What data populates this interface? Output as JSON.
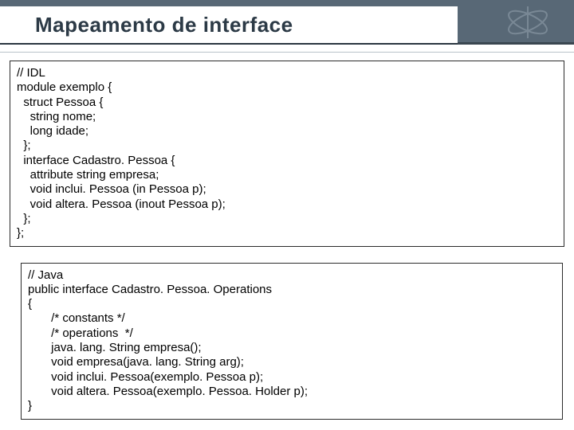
{
  "title": "Mapeamento de interface",
  "idl": {
    "l1": "// IDL",
    "l2": "module exemplo {",
    "l3": "  struct Pessoa {",
    "l4": "    string nome;",
    "l5": "    long idade;",
    "l6": "  };",
    "l7": "  interface Cadastro. Pessoa {",
    "l8": "    attribute string empresa;",
    "l9": "    void inclui. Pessoa (in Pessoa p);",
    "l10": "    void altera. Pessoa (inout Pessoa p);",
    "l11": "  };",
    "l12": "};"
  },
  "java": {
    "l1": "// Java",
    "l2": "public interface Cadastro. Pessoa. Operations",
    "l3": "{",
    "l4": "       /* constants */",
    "l5": "       /* operations  */",
    "l6": "       java. lang. String empresa();",
    "l7": "       void empresa(java. lang. String arg);",
    "l8": "       void inclui. Pessoa(exemplo. Pessoa p);",
    "l9": "       void altera. Pessoa(exemplo. Pessoa. Holder p);",
    "l10": "}"
  }
}
